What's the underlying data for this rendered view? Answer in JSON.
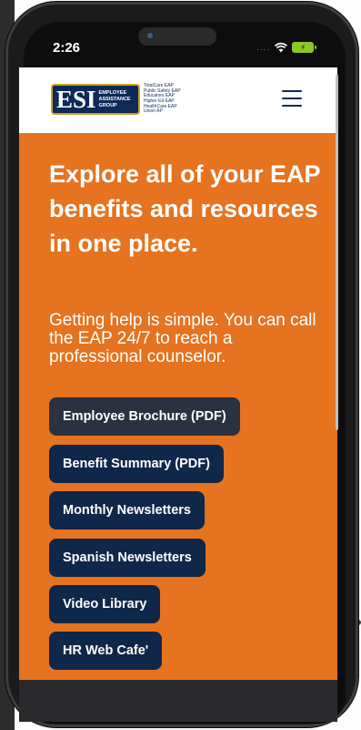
{
  "status": {
    "time": "2:26",
    "signal": "....",
    "wifi_icon": "wifi-icon",
    "battery_icon": "battery-charging-icon"
  },
  "header": {
    "logo": {
      "mark": "ESI",
      "subtitle": [
        "EMPLOYEE",
        "ASSISTANCE",
        "GROUP"
      ],
      "programs": [
        "TotalCare EAP",
        "Public Safety EAP",
        "Educators EAP",
        "Higher Ed EAP",
        "HealthCare EAP",
        "Union AP"
      ]
    },
    "menu_icon": "hamburger-menu-icon"
  },
  "hero": {
    "headline": "Explore all of your EAP benefits and resources in one place.",
    "subtext": "Getting help is simple. You can call the EAP 24/7 to reach a professional counselor.",
    "buttons": [
      "Employee Brochure (PDF)",
      "Benefit Summary (PDF)",
      "Monthly Newsletters",
      "Spanish Newsletters",
      "Video Library",
      "HR Web Cafe'"
    ]
  },
  "colors": {
    "accent": "#e6731f",
    "brand_navy": "#0d2a58",
    "button_bg": "#0f2748",
    "button_active": "#2b3140",
    "logo_gold": "#c9a227"
  }
}
